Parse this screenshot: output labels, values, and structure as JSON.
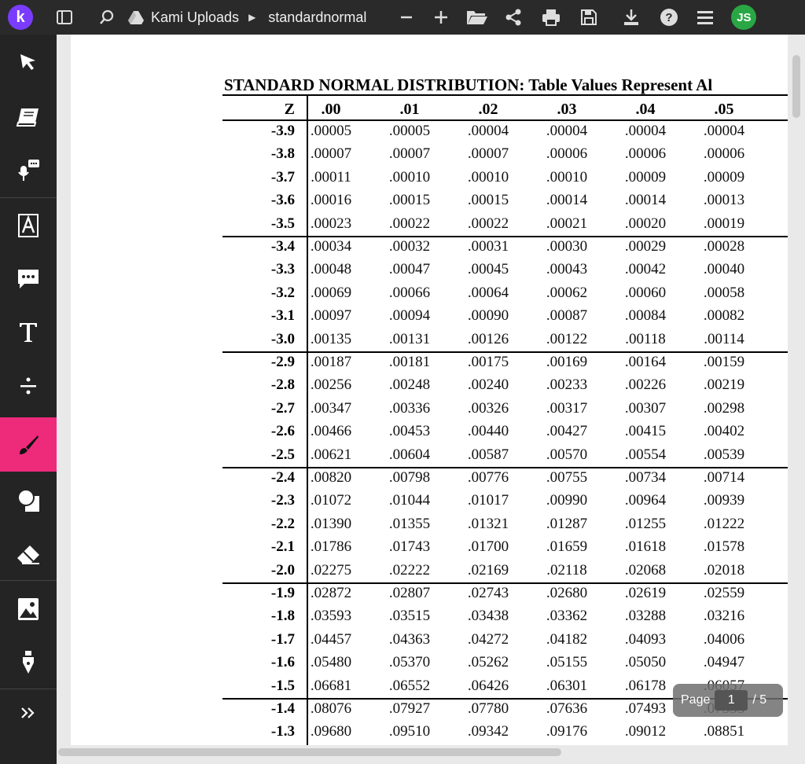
{
  "topbar": {
    "logo_letter": "k",
    "folder": "Kami Uploads",
    "file": "standardnormal",
    "avatar_initials": "JS"
  },
  "document": {
    "title": "STANDARD NORMAL DISTRIBUTION: Table Values Represent Al",
    "header_z": "Z",
    "columns": [
      ".00",
      ".01",
      ".02",
      ".03",
      ".04",
      ".05"
    ],
    "rows": [
      {
        "z": "-3.9",
        "v": [
          ".00005",
          ".00005",
          ".00004",
          ".00004",
          ".00004",
          ".00004"
        ]
      },
      {
        "z": "-3.8",
        "v": [
          ".00007",
          ".00007",
          ".00007",
          ".00006",
          ".00006",
          ".00006"
        ]
      },
      {
        "z": "-3.7",
        "v": [
          ".00011",
          ".00010",
          ".00010",
          ".00010",
          ".00009",
          ".00009"
        ]
      },
      {
        "z": "-3.6",
        "v": [
          ".00016",
          ".00015",
          ".00015",
          ".00014",
          ".00014",
          ".00013"
        ]
      },
      {
        "z": "-3.5",
        "v": [
          ".00023",
          ".00022",
          ".00022",
          ".00021",
          ".00020",
          ".00019"
        ]
      },
      {
        "z": "-3.4",
        "v": [
          ".00034",
          ".00032",
          ".00031",
          ".00030",
          ".00029",
          ".00028"
        ]
      },
      {
        "z": "-3.3",
        "v": [
          ".00048",
          ".00047",
          ".00045",
          ".00043",
          ".00042",
          ".00040"
        ]
      },
      {
        "z": "-3.2",
        "v": [
          ".00069",
          ".00066",
          ".00064",
          ".00062",
          ".00060",
          ".00058"
        ]
      },
      {
        "z": "-3.1",
        "v": [
          ".00097",
          ".00094",
          ".00090",
          ".00087",
          ".00084",
          ".00082"
        ]
      },
      {
        "z": "-3.0",
        "v": [
          ".00135",
          ".00131",
          ".00126",
          ".00122",
          ".00118",
          ".00114"
        ]
      },
      {
        "z": "-2.9",
        "v": [
          ".00187",
          ".00181",
          ".00175",
          ".00169",
          ".00164",
          ".00159"
        ]
      },
      {
        "z": "-2.8",
        "v": [
          ".00256",
          ".00248",
          ".00240",
          ".00233",
          ".00226",
          ".00219"
        ]
      },
      {
        "z": "-2.7",
        "v": [
          ".00347",
          ".00336",
          ".00326",
          ".00317",
          ".00307",
          ".00298"
        ]
      },
      {
        "z": "-2.6",
        "v": [
          ".00466",
          ".00453",
          ".00440",
          ".00427",
          ".00415",
          ".00402"
        ]
      },
      {
        "z": "-2.5",
        "v": [
          ".00621",
          ".00604",
          ".00587",
          ".00570",
          ".00554",
          ".00539"
        ]
      },
      {
        "z": "-2.4",
        "v": [
          ".00820",
          ".00798",
          ".00776",
          ".00755",
          ".00734",
          ".00714"
        ]
      },
      {
        "z": "-2.3",
        "v": [
          ".01072",
          ".01044",
          ".01017",
          ".00990",
          ".00964",
          ".00939"
        ]
      },
      {
        "z": "-2.2",
        "v": [
          ".01390",
          ".01355",
          ".01321",
          ".01287",
          ".01255",
          ".01222"
        ]
      },
      {
        "z": "-2.1",
        "v": [
          ".01786",
          ".01743",
          ".01700",
          ".01659",
          ".01618",
          ".01578"
        ]
      },
      {
        "z": "-2.0",
        "v": [
          ".02275",
          ".02222",
          ".02169",
          ".02118",
          ".02068",
          ".02018"
        ]
      },
      {
        "z": "-1.9",
        "v": [
          ".02872",
          ".02807",
          ".02743",
          ".02680",
          ".02619",
          ".02559"
        ]
      },
      {
        "z": "-1.8",
        "v": [
          ".03593",
          ".03515",
          ".03438",
          ".03362",
          ".03288",
          ".03216"
        ]
      },
      {
        "z": "-1.7",
        "v": [
          ".04457",
          ".04363",
          ".04272",
          ".04182",
          ".04093",
          ".04006"
        ]
      },
      {
        "z": "-1.6",
        "v": [
          ".05480",
          ".05370",
          ".05262",
          ".05155",
          ".05050",
          ".04947"
        ]
      },
      {
        "z": "-1.5",
        "v": [
          ".06681",
          ".06552",
          ".06426",
          ".06301",
          ".06178",
          ".06057"
        ]
      },
      {
        "z": "-1.4",
        "v": [
          ".08076",
          ".07927",
          ".07780",
          ".07636",
          ".07493",
          ".07353"
        ]
      },
      {
        "z": "-1.3",
        "v": [
          ".09680",
          ".09510",
          ".09342",
          ".09176",
          ".09012",
          ".08851"
        ]
      }
    ]
  },
  "pager": {
    "label": "Page",
    "current": "1",
    "total": "/ 5"
  },
  "colors": {
    "accent": "#ee2a7b",
    "logo": "#7a3cff",
    "avatar": "#29a745"
  },
  "icons": {
    "topbar": [
      "sidebar-toggle-icon",
      "search-icon",
      "drive-icon",
      "caret-right-icon",
      "zoom-out-icon",
      "zoom-in-icon",
      "folder-open-icon",
      "share-icon",
      "print-icon",
      "save-icon",
      "download-icon",
      "help-icon",
      "menu-icon"
    ],
    "sidebar": [
      "select-arrow-icon",
      "dictionary-icon",
      "voice-comment-icon",
      "markup-icon",
      "comment-icon",
      "text-icon",
      "equation-icon",
      "drawing-icon",
      "shapes-icon",
      "eraser-icon",
      "image-icon",
      "signature-icon",
      "expand-icon"
    ]
  }
}
